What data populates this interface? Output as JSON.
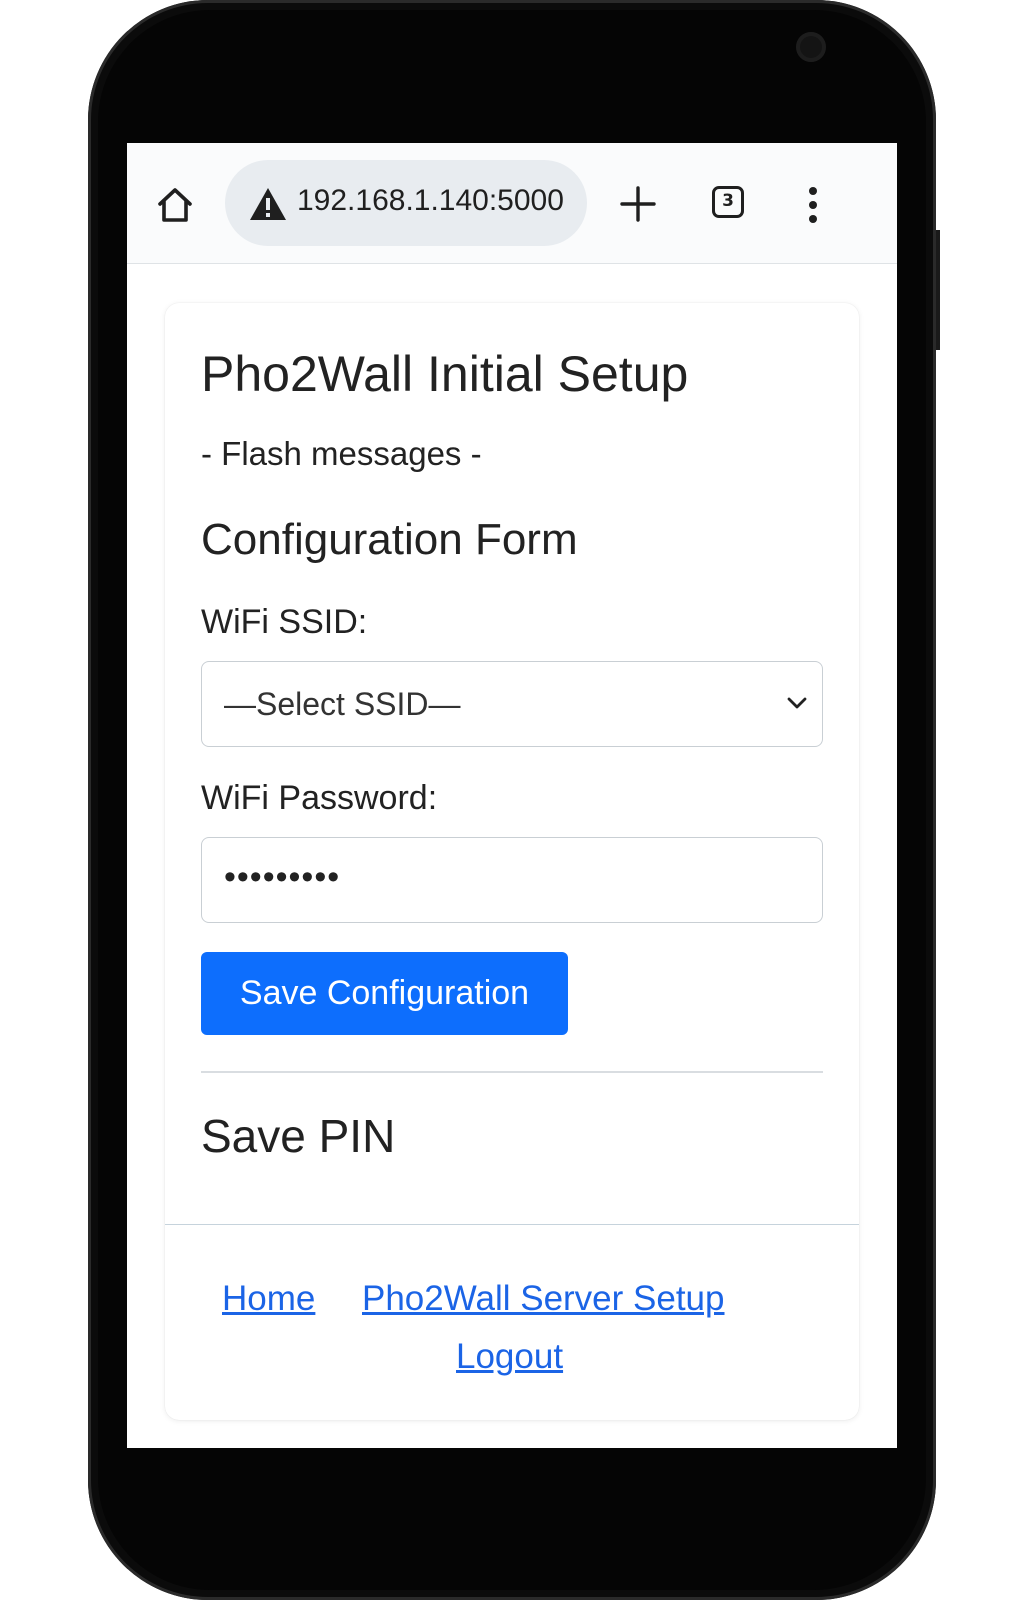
{
  "browser": {
    "url": "192.168.1.140:5000",
    "tab_count": "3"
  },
  "page": {
    "title": "Pho2Wall Initial Setup",
    "flash_messages": "- Flash messages -"
  },
  "form": {
    "title": "Configuration Form",
    "ssid_label": "WiFi SSID:",
    "ssid_selected": "—Select SSID—",
    "password_label": "WiFi Password:",
    "password_value": "•••••••••",
    "save_button": "Save Configuration"
  },
  "pin": {
    "title": "Save PIN"
  },
  "footer": {
    "links": [
      "Home",
      "Pho2Wall Server Setup",
      "Logout"
    ]
  },
  "colors": {
    "accent": "#0d6efd",
    "link": "#1b64e6"
  }
}
